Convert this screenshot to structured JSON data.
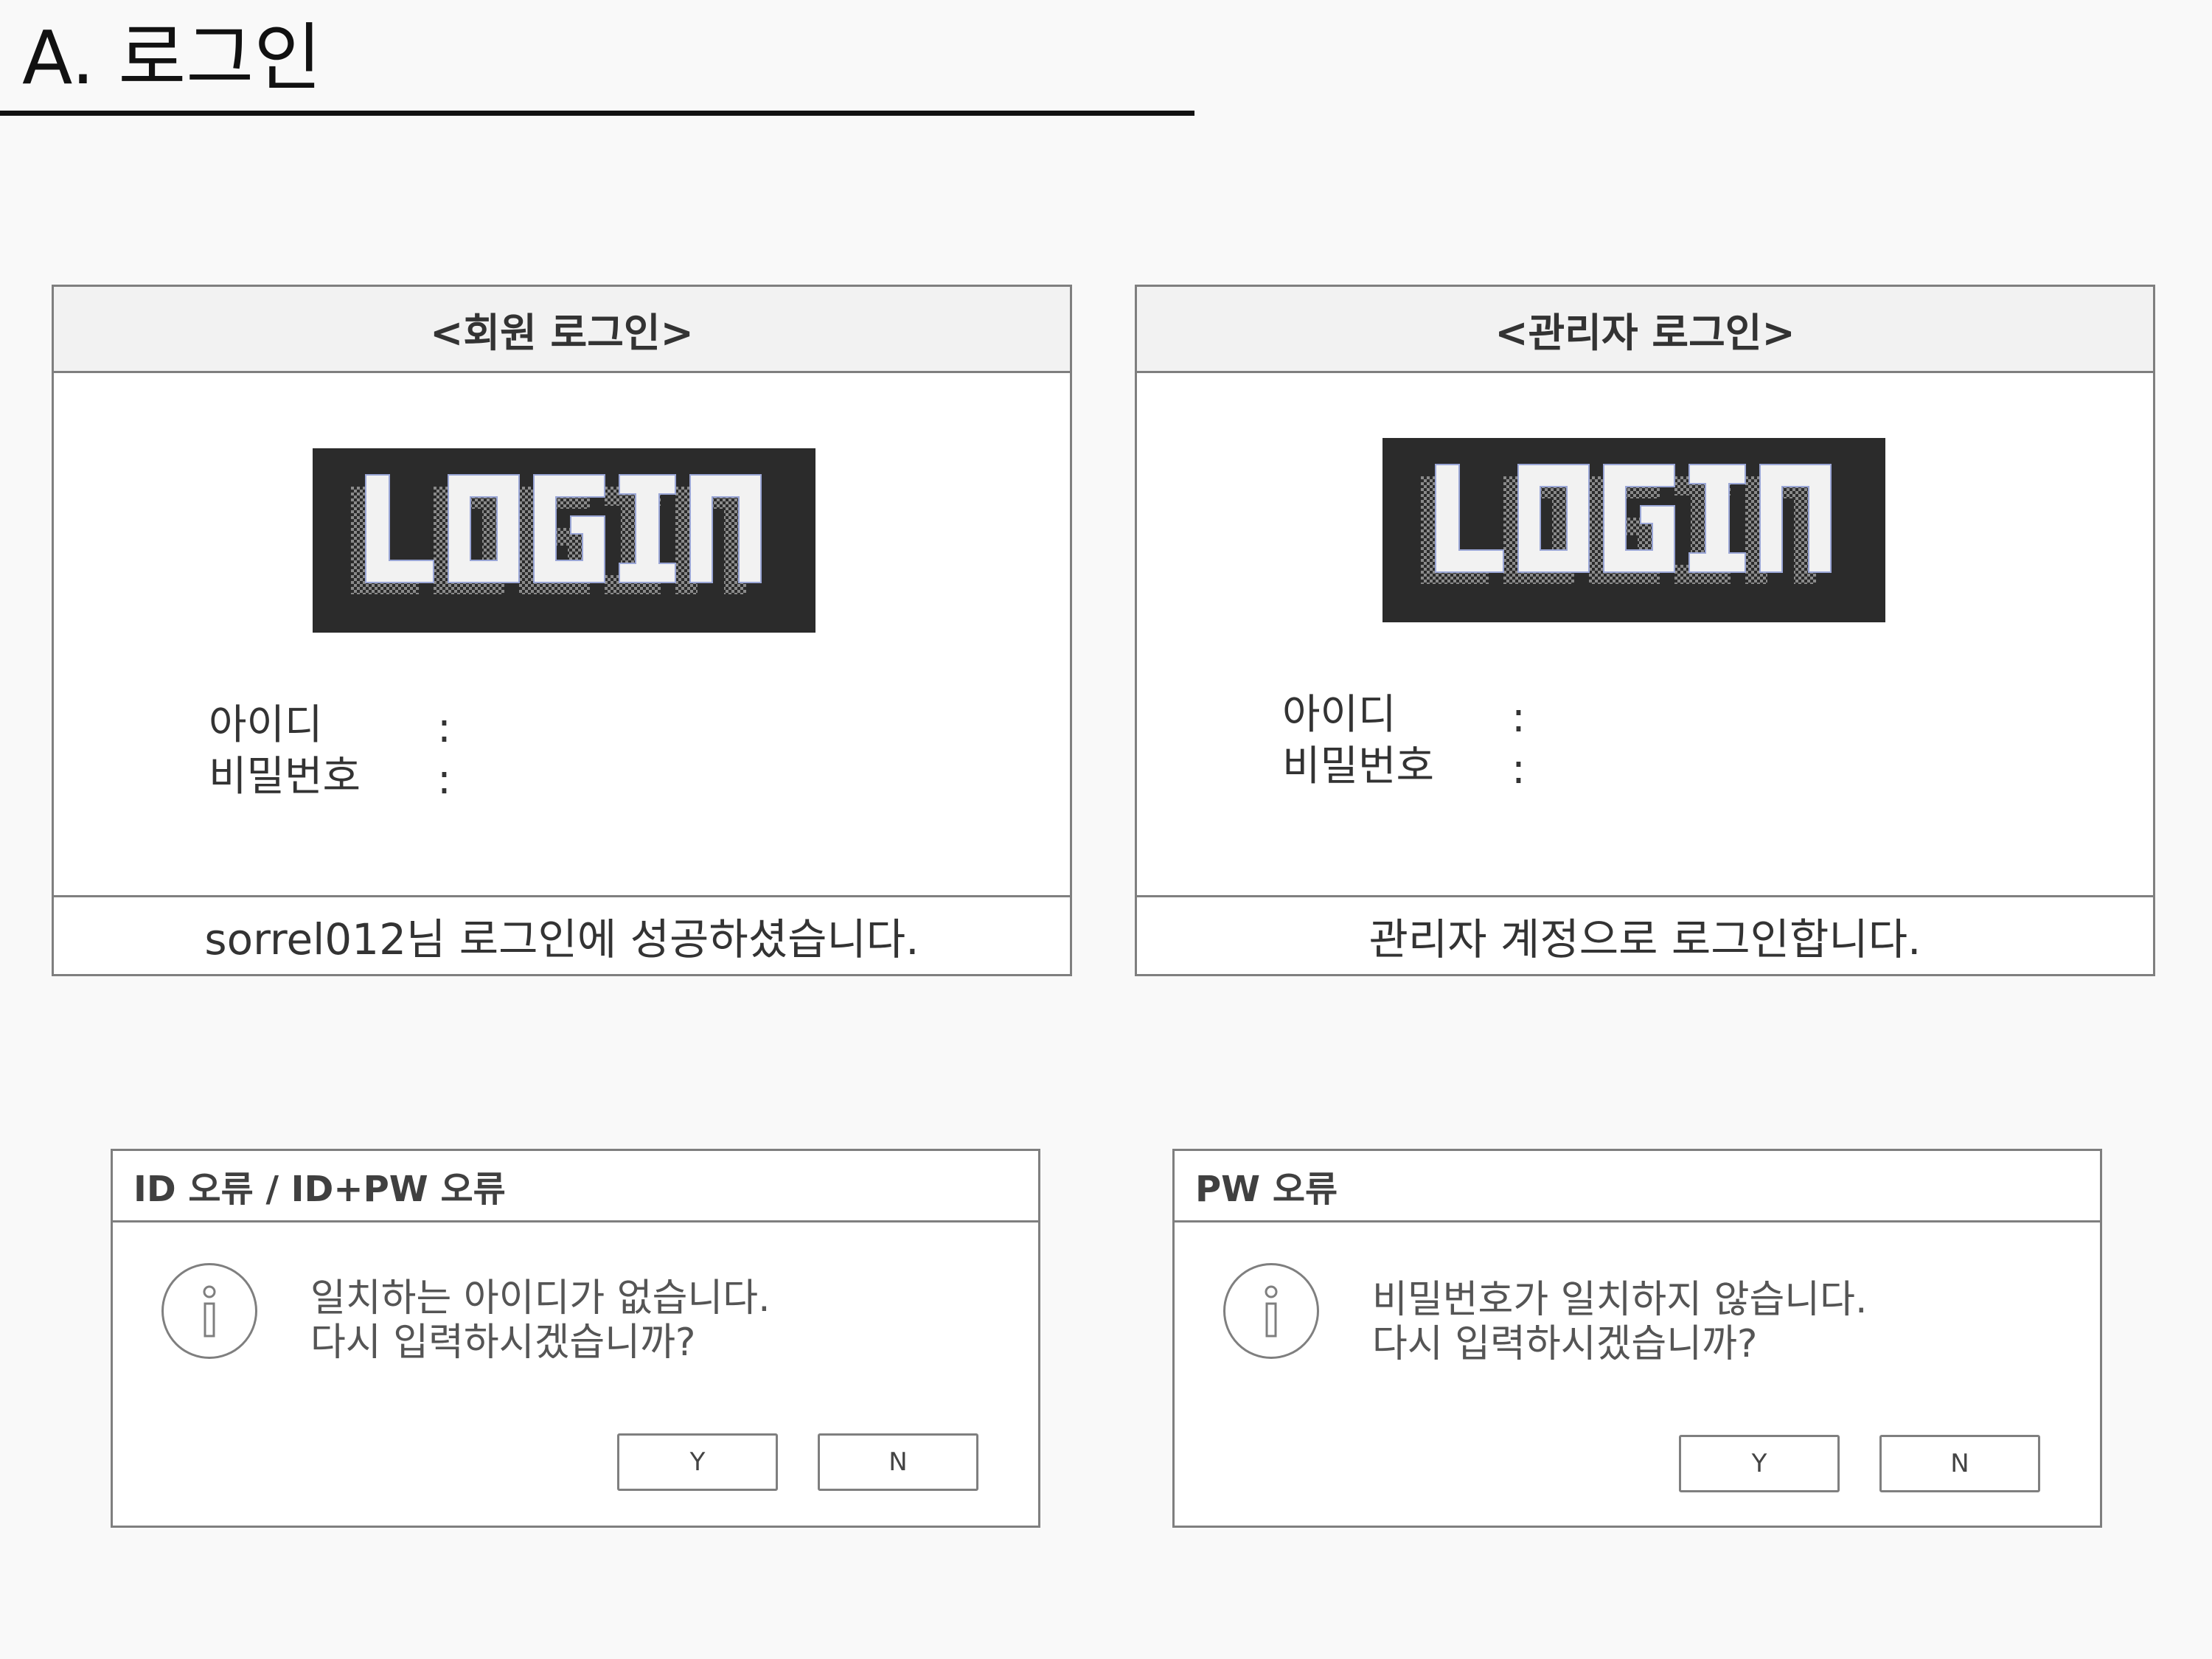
{
  "page": {
    "title": "A. 로그인"
  },
  "member_login": {
    "header": "<회원 로그인>",
    "logo_text": "LOGIN",
    "id_label": "아이디",
    "pw_label": "비밀번호",
    "colon": ":",
    "status": "sorrel012님 로그인에 성공하셨습니다."
  },
  "admin_login": {
    "header": "<관리자 로그인>",
    "logo_text": "LOGIN",
    "id_label": "아이디",
    "pw_label": "비밀번호",
    "colon": ":",
    "status": "관리자 계정으로 로그인합니다."
  },
  "id_error_dialog": {
    "title": "ID 오류 / ID+PW 오류",
    "icon": "info-icon",
    "message_line1": "일치하는 아이디가 없습니다.",
    "message_line2": "다시 입력하시겠습니까?",
    "yes_label": "Y",
    "no_label": "N"
  },
  "pw_error_dialog": {
    "title": "PW 오류",
    "icon": "info-icon",
    "message_line1": "비밀번호가 일치하지 않습니다.",
    "message_line2": "다시 입력하시겠습니까?",
    "yes_label": "Y",
    "no_label": "N"
  },
  "colors": {
    "page_background": "#f9f9f9",
    "panel_border": "#7f7f7f",
    "header_fill": "#f2f2f2",
    "logo_background": "#2b2b2b",
    "logo_letters": "#f2f2f2"
  }
}
